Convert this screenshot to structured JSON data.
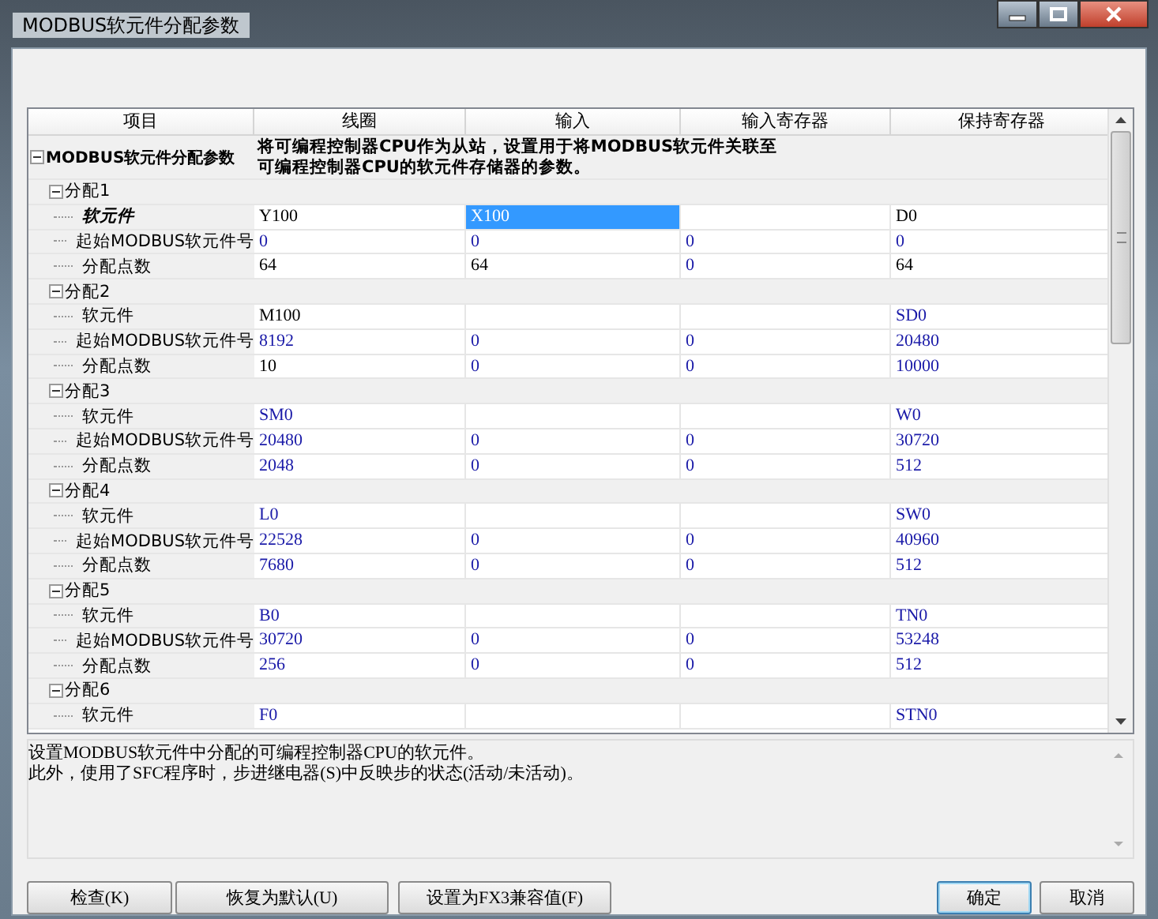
{
  "window": {
    "title": "MODBUS软元件分配参数"
  },
  "columns": [
    "项目",
    "线圈",
    "输入",
    "输入寄存器",
    "保持寄存器"
  ],
  "root": {
    "label": "MODBUS软元件分配参数",
    "expanded": true,
    "description_lines": [
      "将可编程控制器CPU作为从站，设置用于将MODBUS软元件关联至",
      "可编程控制器CPU的软元件存储器的参数。"
    ]
  },
  "groups": [
    {
      "label": "分配1",
      "expanded": true,
      "children": [
        {
          "label": "软元件",
          "selected": true,
          "cells": [
            {
              "text": "Y100",
              "modified": true,
              "selected": false
            },
            {
              "text": "X100",
              "modified": true,
              "selected": true
            },
            {
              "selected": false
            },
            {
              "text": "D0",
              "modified": true,
              "selected": false
            }
          ]
        },
        {
          "label": "起始MODBUS软元件号",
          "selected": false,
          "cells": [
            {
              "text": "0",
              "modified": false,
              "selected": false
            },
            {
              "text": "0",
              "modified": false,
              "selected": false
            },
            {
              "text": "0",
              "modified": false,
              "selected": false
            },
            {
              "text": "0",
              "modified": false,
              "selected": false
            }
          ]
        },
        {
          "label": "分配点数",
          "selected": false,
          "cells": [
            {
              "text": "64",
              "modified": true,
              "selected": false
            },
            {
              "text": "64",
              "modified": true,
              "selected": false
            },
            {
              "text": "0",
              "modified": false,
              "selected": false
            },
            {
              "text": "64",
              "modified": true,
              "selected": false
            }
          ]
        }
      ]
    },
    {
      "label": "分配2",
      "expanded": true,
      "children": [
        {
          "label": "软元件",
          "selected": false,
          "cells": [
            {
              "text": "M100",
              "modified": true,
              "selected": false
            },
            {
              "selected": false
            },
            {
              "selected": false
            },
            {
              "text": "SD0",
              "modified": false,
              "selected": false
            }
          ]
        },
        {
          "label": "起始MODBUS软元件号",
          "selected": false,
          "cells": [
            {
              "text": "8192",
              "modified": false,
              "selected": false
            },
            {
              "text": "0",
              "modified": false,
              "selected": false
            },
            {
              "text": "0",
              "modified": false,
              "selected": false
            },
            {
              "text": "20480",
              "modified": false,
              "selected": false
            }
          ]
        },
        {
          "label": "分配点数",
          "selected": false,
          "cells": [
            {
              "text": "10",
              "modified": true,
              "selected": false
            },
            {
              "text": "0",
              "modified": false,
              "selected": false
            },
            {
              "text": "0",
              "modified": false,
              "selected": false
            },
            {
              "text": "10000",
              "modified": false,
              "selected": false
            }
          ]
        }
      ]
    },
    {
      "label": "分配3",
      "expanded": true,
      "children": [
        {
          "label": "软元件",
          "selected": false,
          "cells": [
            {
              "text": "SM0",
              "modified": false,
              "selected": false
            },
            {
              "selected": false
            },
            {
              "selected": false
            },
            {
              "text": "W0",
              "modified": false,
              "selected": false
            }
          ]
        },
        {
          "label": "起始MODBUS软元件号",
          "selected": false,
          "cells": [
            {
              "text": "20480",
              "modified": false,
              "selected": false
            },
            {
              "text": "0",
              "modified": false,
              "selected": false
            },
            {
              "text": "0",
              "modified": false,
              "selected": false
            },
            {
              "text": "30720",
              "modified": false,
              "selected": false
            }
          ]
        },
        {
          "label": "分配点数",
          "selected": false,
          "cells": [
            {
              "text": "2048",
              "modified": false,
              "selected": false
            },
            {
              "text": "0",
              "modified": false,
              "selected": false
            },
            {
              "text": "0",
              "modified": false,
              "selected": false
            },
            {
              "text": "512",
              "modified": false,
              "selected": false
            }
          ]
        }
      ]
    },
    {
      "label": "分配4",
      "expanded": true,
      "children": [
        {
          "label": "软元件",
          "selected": false,
          "cells": [
            {
              "text": "L0",
              "modified": false,
              "selected": false
            },
            {
              "selected": false
            },
            {
              "selected": false
            },
            {
              "text": "SW0",
              "modified": false,
              "selected": false
            }
          ]
        },
        {
          "label": "起始MODBUS软元件号",
          "selected": false,
          "cells": [
            {
              "text": "22528",
              "modified": false,
              "selected": false
            },
            {
              "text": "0",
              "modified": false,
              "selected": false
            },
            {
              "text": "0",
              "modified": false,
              "selected": false
            },
            {
              "text": "40960",
              "modified": false,
              "selected": false
            }
          ]
        },
        {
          "label": "分配点数",
          "selected": false,
          "cells": [
            {
              "text": "7680",
              "modified": false,
              "selected": false
            },
            {
              "text": "0",
              "modified": false,
              "selected": false
            },
            {
              "text": "0",
              "modified": false,
              "selected": false
            },
            {
              "text": "512",
              "modified": false,
              "selected": false
            }
          ]
        }
      ]
    },
    {
      "label": "分配5",
      "expanded": true,
      "children": [
        {
          "label": "软元件",
          "selected": false,
          "cells": [
            {
              "text": "B0",
              "modified": false,
              "selected": false
            },
            {
              "selected": false
            },
            {
              "selected": false
            },
            {
              "text": "TN0",
              "modified": false,
              "selected": false
            }
          ]
        },
        {
          "label": "起始MODBUS软元件号",
          "selected": false,
          "cells": [
            {
              "text": "30720",
              "modified": false,
              "selected": false
            },
            {
              "text": "0",
              "modified": false,
              "selected": false
            },
            {
              "text": "0",
              "modified": false,
              "selected": false
            },
            {
              "text": "53248",
              "modified": false,
              "selected": false
            }
          ]
        },
        {
          "label": "分配点数",
          "selected": false,
          "cells": [
            {
              "text": "256",
              "modified": false,
              "selected": false
            },
            {
              "text": "0",
              "modified": false,
              "selected": false
            },
            {
              "text": "0",
              "modified": false,
              "selected": false
            },
            {
              "text": "512",
              "modified": false,
              "selected": false
            }
          ]
        }
      ]
    },
    {
      "label": "分配6",
      "expanded": true,
      "children": [
        {
          "label": "软元件",
          "selected": false,
          "cells": [
            {
              "text": "F0",
              "modified": false,
              "selected": false
            },
            {
              "selected": false
            },
            {
              "selected": false
            },
            {
              "text": "STN0",
              "modified": false,
              "selected": false
            }
          ]
        }
      ]
    }
  ],
  "help_lines": [
    "设置MODBUS软元件中分配的可编程控制器CPU的软元件。",
    "此外，使用了SFC程序时，步进继电器(S)中反映步的状态(活动/未活动)。"
  ],
  "buttons_left": [
    "检查(K)",
    "恢复为默认(U)",
    "设置为FX3兼容值(F)"
  ],
  "buttons_right": [
    {
      "label": "确定",
      "default": true
    },
    {
      "label": "取消",
      "default": false
    }
  ]
}
